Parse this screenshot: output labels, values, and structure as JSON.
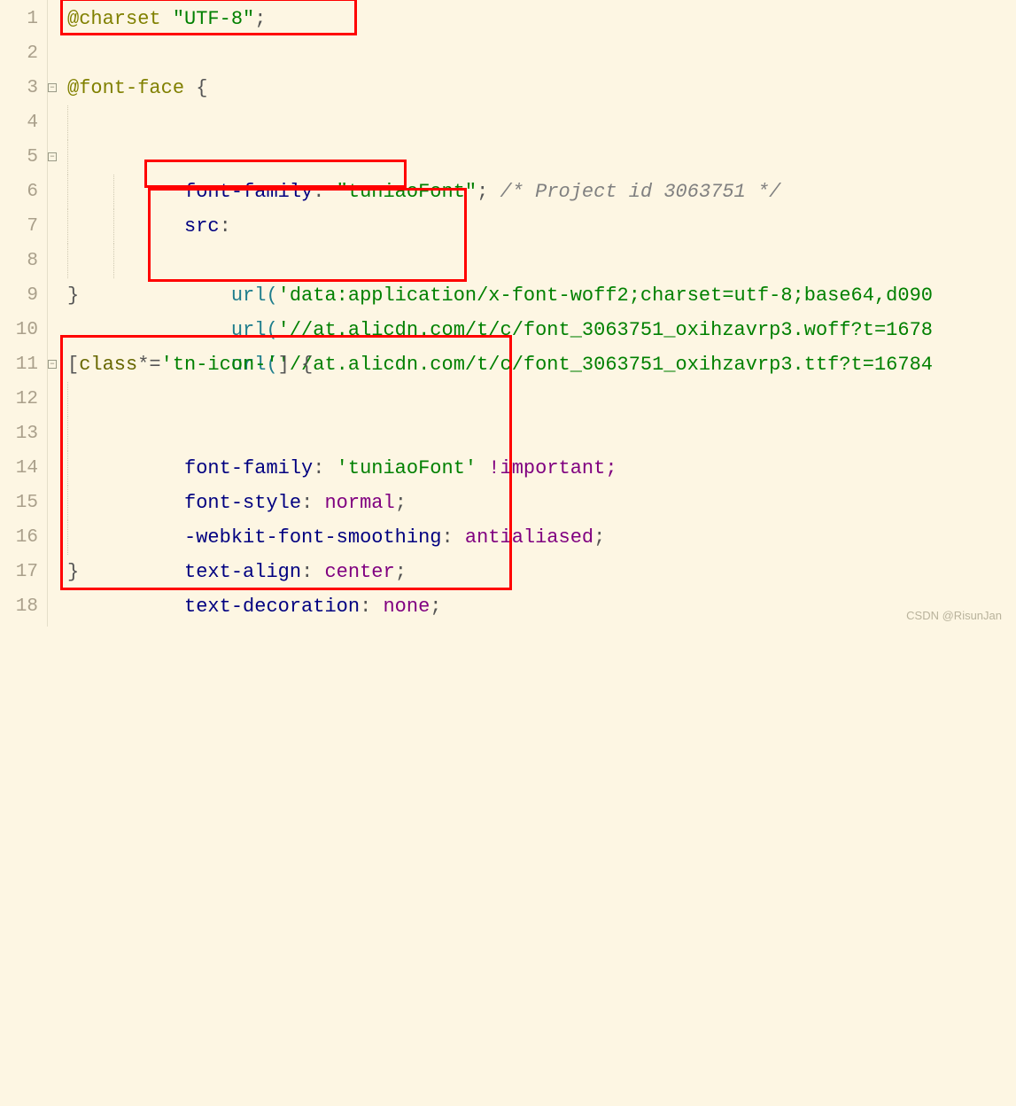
{
  "lineNumbers": [
    "1",
    "2",
    "3",
    "4",
    "5",
    "6",
    "7",
    "8",
    "9",
    "10",
    "11",
    "12",
    "13",
    "14",
    "15",
    "16",
    "17",
    "18"
  ],
  "code": {
    "l1": {
      "a": "@charset",
      "b": " \"UTF-8\"",
      "c": ";"
    },
    "l3": {
      "a": "@font-face",
      "b": " {"
    },
    "l4": {
      "a": "font-family",
      "b": ": ",
      "c": "\"tuniaoFont\"",
      "d": ";",
      "e": " /* Project id 3063751 */"
    },
    "l5": {
      "a": "src",
      "b": ":"
    },
    "l6": {
      "a": "url(",
      "b": "'data:application/x-font-woff2;charset=utf-8;base64,d090"
    },
    "l7": {
      "a": "url(",
      "b": "'//at.alicdn.com/t/c/font_3063751_oxihzavrp3.woff?t=1678"
    },
    "l8": {
      "a": "url(",
      "b": "'//at.alicdn.com/t/c/font_3063751_oxihzavrp3.ttf?t=16784"
    },
    "l9": {
      "a": "}"
    },
    "l11": {
      "a": "[",
      "b": "class",
      "c": "*=",
      "d": "'tn-icon-'",
      "e": "] {"
    },
    "l12": {
      "a": "font-family",
      "b": ": ",
      "c": "'tuniaoFont'",
      "d": " !important;"
    },
    "l13": {
      "a": "font-style",
      "b": ": ",
      "c": "normal",
      "d": ";"
    },
    "l14": {
      "a": "-webkit-font-smoothing",
      "b": ": ",
      "c": "antialiased",
      "d": ";"
    },
    "l15": {
      "a": "text-align",
      "b": ": ",
      "c": "center",
      "d": ";"
    },
    "l16": {
      "a": "text-decoration",
      "b": ": ",
      "c": "none",
      "d": ";"
    },
    "l17": {
      "a": "}"
    }
  },
  "fold": {
    "f3": "−",
    "f5": "−",
    "f11": "−"
  },
  "watermark": "CSDN @RisunJan"
}
